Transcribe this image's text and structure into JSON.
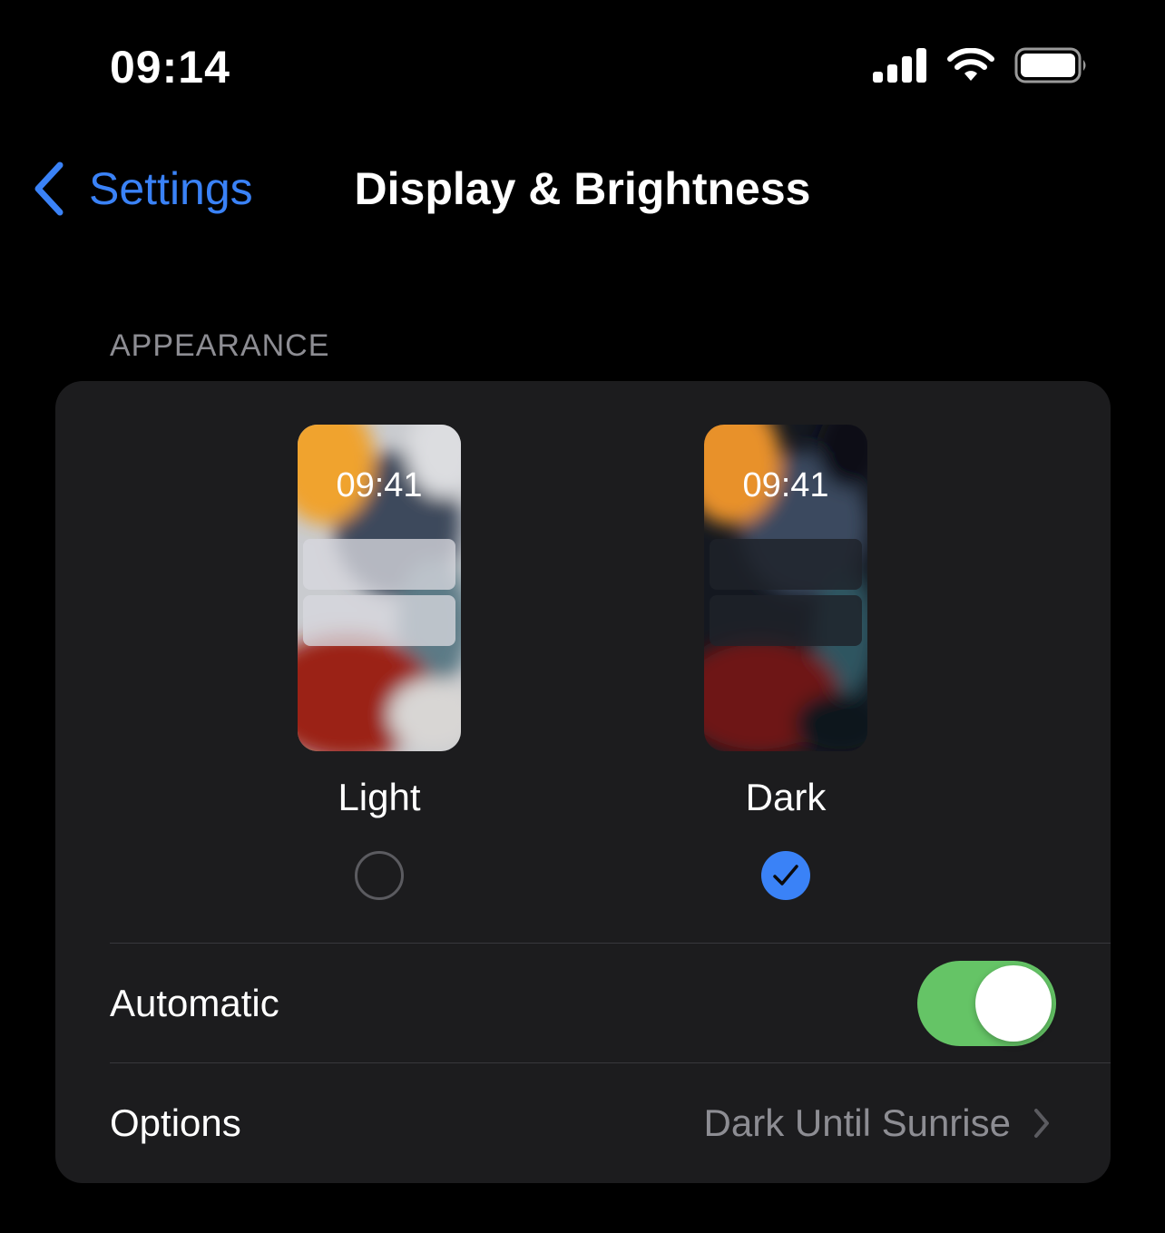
{
  "status_bar": {
    "time": "09:14",
    "icons": [
      "cellular-signal-icon",
      "wifi-icon",
      "battery-icon"
    ],
    "battery_level": 1.0
  },
  "nav": {
    "back_label": "Settings",
    "title": "Display & Brightness"
  },
  "appearance": {
    "section_header": "APPEARANCE",
    "options": [
      {
        "label": "Light",
        "preview_time": "09:41",
        "selected": false
      },
      {
        "label": "Dark",
        "preview_time": "09:41",
        "selected": true
      }
    ],
    "automatic": {
      "label": "Automatic",
      "on": true
    },
    "options_row": {
      "label": "Options",
      "value": "Dark Until Sunrise"
    }
  },
  "colors": {
    "accent": "#3a82f7",
    "toggle_on": "#65c466",
    "card_bg": "#1c1c1e",
    "secondary_text": "#8d8d93"
  }
}
